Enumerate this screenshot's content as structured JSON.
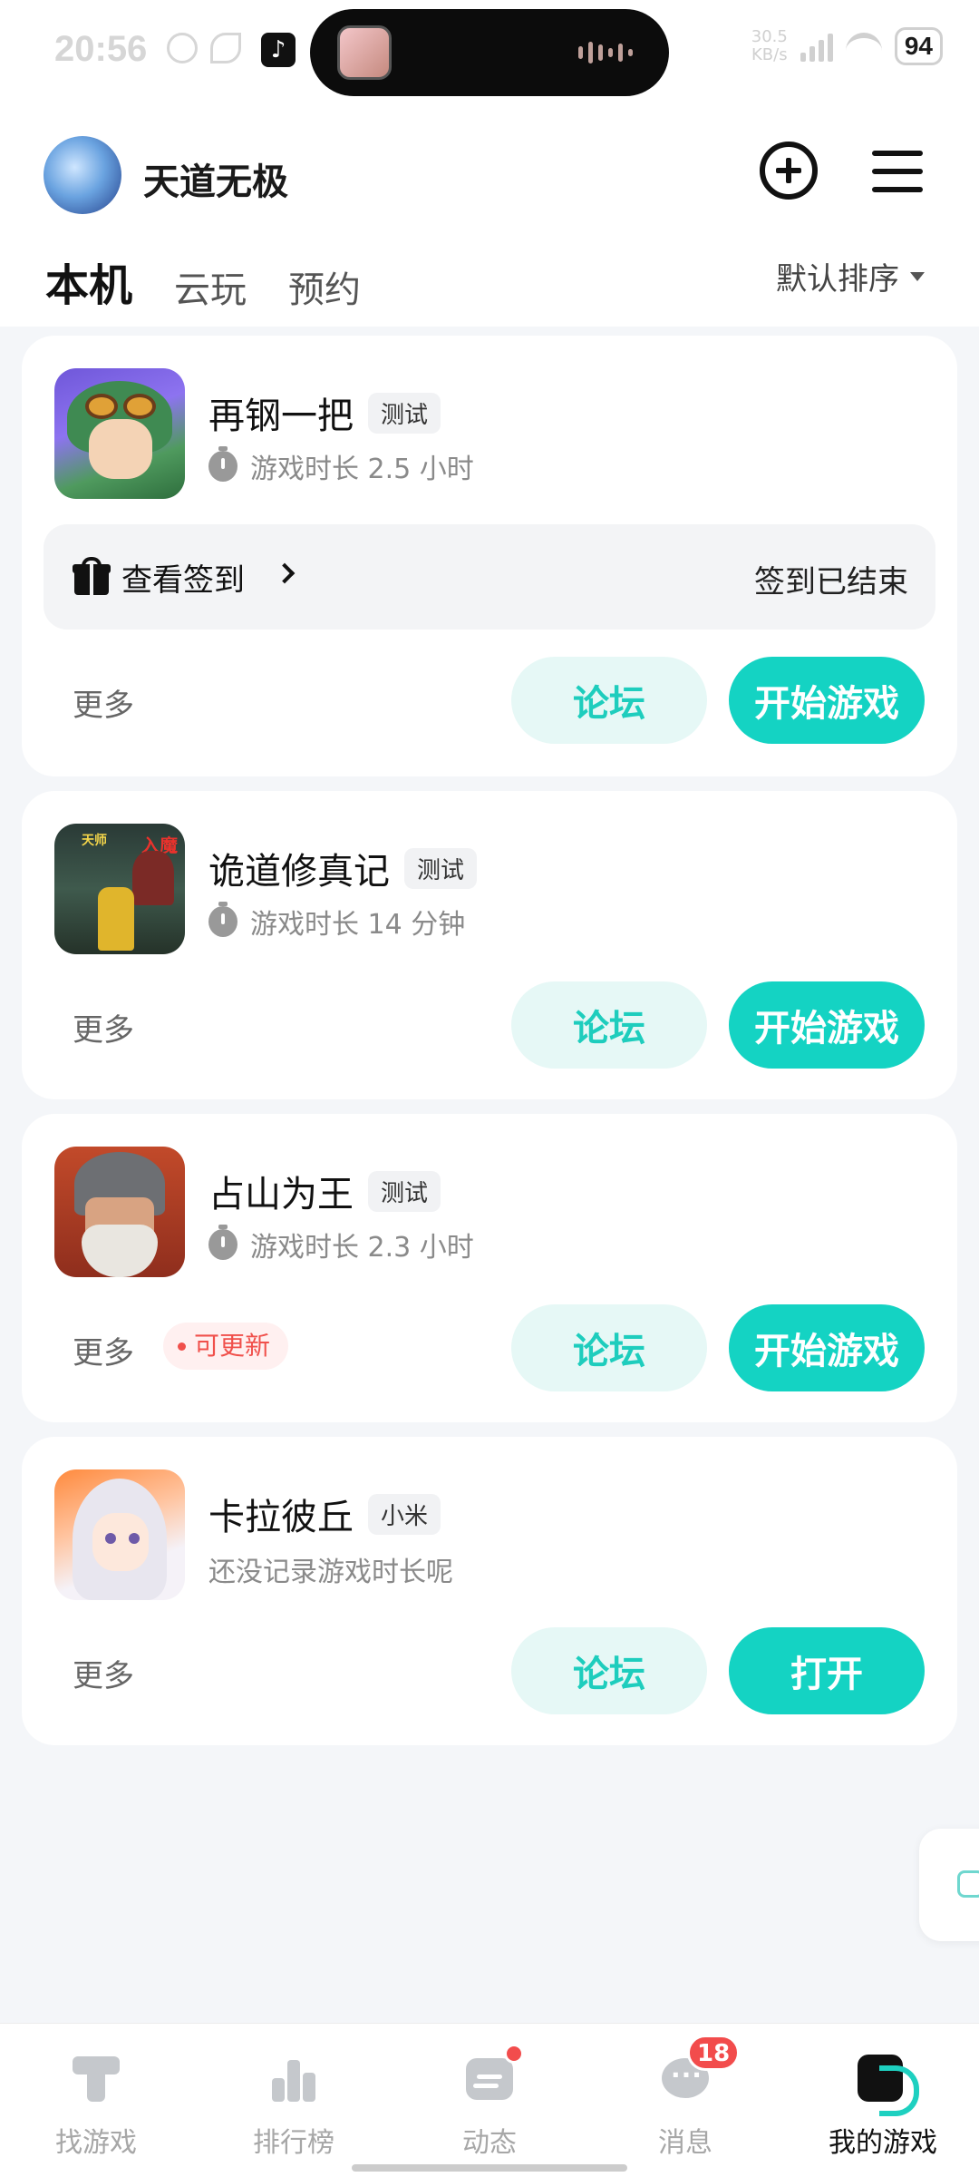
{
  "status_bar": {
    "time": "20:56",
    "network_speed": "30.5\nKB/s",
    "battery": "94"
  },
  "header": {
    "username": "天道无极",
    "tabs": [
      {
        "label": "本机",
        "active": true
      },
      {
        "label": "云玩",
        "active": false
      },
      {
        "label": "预约",
        "active": false
      }
    ],
    "sort_label": "默认排序"
  },
  "games": [
    {
      "name": "再钢一把",
      "tag": "测试",
      "playtime": "游戏时长 2.5 小时",
      "checkin_label": "查看签到",
      "checkin_status": "签到已结束",
      "more": "更多",
      "forum": "论坛",
      "action": "开始游戏"
    },
    {
      "name": "诡道修真记",
      "tag": "测试",
      "playtime": "游戏时长 14 分钟",
      "more": "更多",
      "forum": "论坛",
      "action": "开始游戏",
      "icon_text": [
        "天师",
        "入魔"
      ]
    },
    {
      "name": "占山为王",
      "tag": "测试",
      "playtime": "游戏时长 2.3 小时",
      "more": "更多",
      "update_badge": "可更新",
      "forum": "论坛",
      "action": "开始游戏"
    },
    {
      "name": "卡拉彼丘",
      "tag": "小米",
      "playtime": "还没记录游戏时长呢",
      "more": "更多",
      "forum": "论坛",
      "action": "打开"
    }
  ],
  "bottom_nav": [
    {
      "label": "找游戏",
      "icon": "find-game-icon"
    },
    {
      "label": "排行榜",
      "icon": "ranking-icon"
    },
    {
      "label": "动态",
      "icon": "feed-icon",
      "dot": true
    },
    {
      "label": "消息",
      "icon": "message-icon",
      "badge": "18"
    },
    {
      "label": "我的游戏",
      "icon": "my-games-icon",
      "active": true
    }
  ],
  "colors": {
    "accent": "#14d3c3",
    "forum_bg": "#e6f8f6",
    "badge_red": "#f24c4c"
  }
}
